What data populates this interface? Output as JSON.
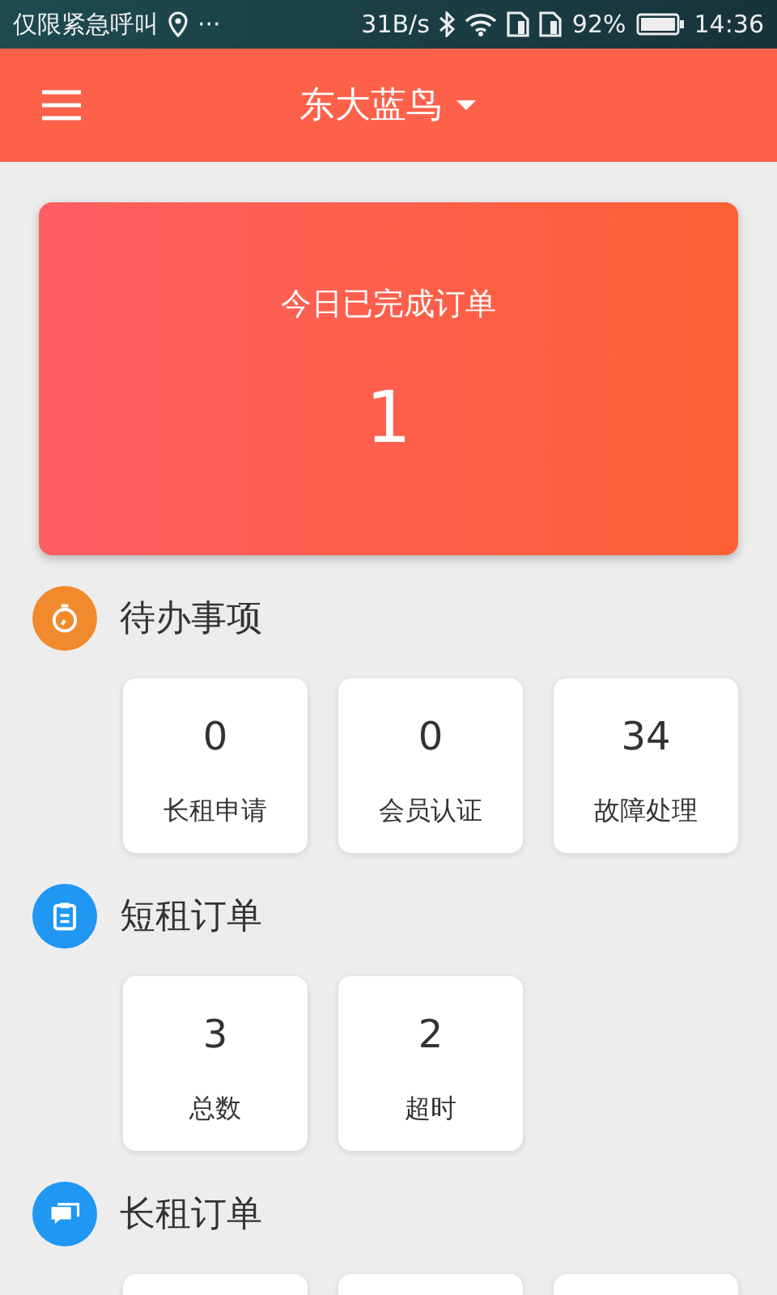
{
  "status_bar": {
    "carrier": "仅限紧急呼叫",
    "more": "···",
    "speed": "31B/s",
    "battery": "92%",
    "time": "14:36"
  },
  "app_bar": {
    "title": "东大蓝鸟"
  },
  "summary": {
    "label": "今日已完成订单",
    "value": "1"
  },
  "sections": [
    {
      "title": "待办事项",
      "kind": "stopwatch",
      "color": "#f08a2c",
      "tiles": [
        {
          "kind": "count",
          "value": "0",
          "label": "长租申请"
        },
        {
          "kind": "count",
          "value": "0",
          "label": "会员认证"
        },
        {
          "kind": "count",
          "value": "34",
          "label": "故障处理"
        }
      ]
    },
    {
      "title": "短租订单",
      "kind": "clipboard",
      "color": "#1f97f3",
      "tiles": [
        {
          "kind": "count",
          "value": "3",
          "label": "总数"
        },
        {
          "kind": "count",
          "value": "2",
          "label": "超时"
        }
      ]
    },
    {
      "title": "长租订单",
      "kind": "chat",
      "color": "#1f97f3",
      "tiles": [
        {
          "kind": "blank"
        },
        {
          "kind": "blank"
        },
        {
          "kind": "blank"
        }
      ]
    }
  ]
}
